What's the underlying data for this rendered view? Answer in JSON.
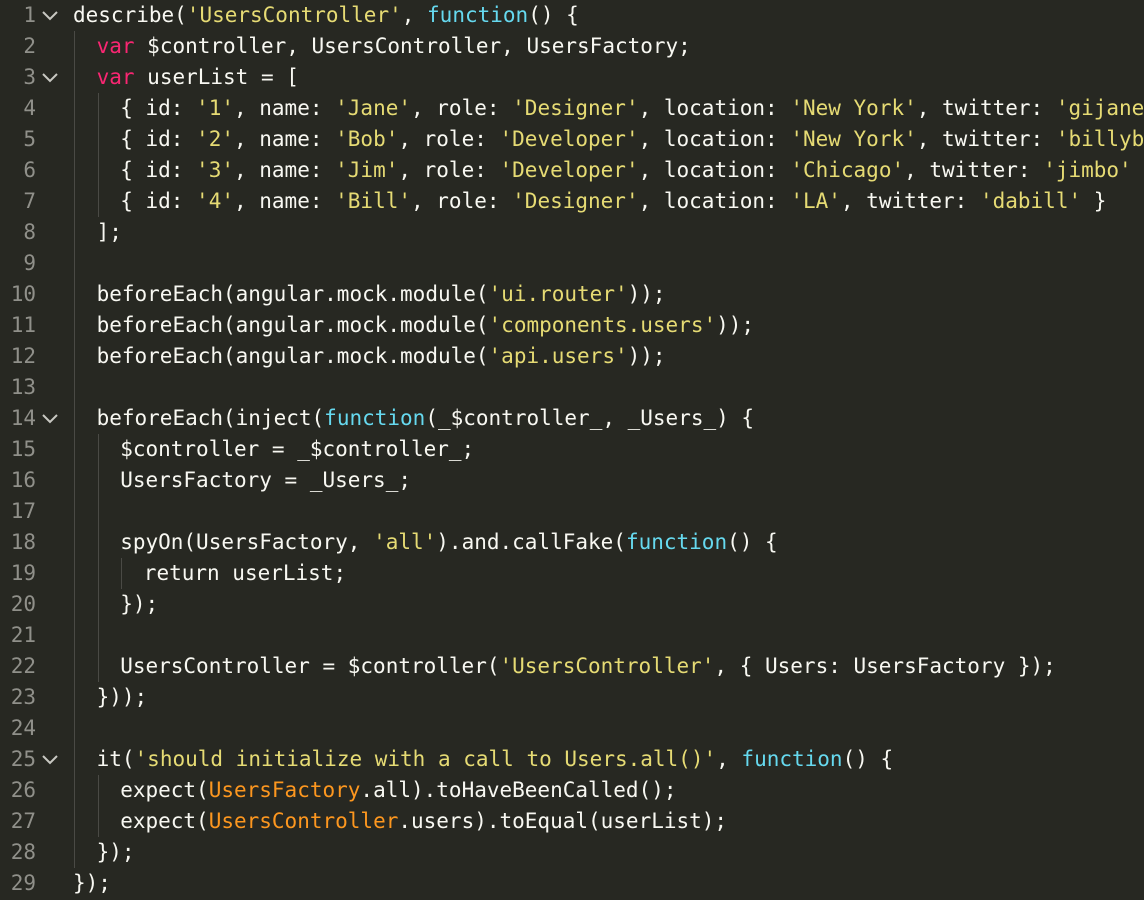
{
  "editor": {
    "theme": {
      "background": "#272822",
      "plain": "#f8f8f2",
      "string": "#e6db74",
      "keyword": "#f92672",
      "function": "#66d9ef",
      "variable": "#fd971f",
      "gutter": "#90908a"
    },
    "fold_icon": "chevron-down-icon",
    "lines": [
      {
        "num": "1",
        "fold": true,
        "indent": 0,
        "tokens": [
          {
            "t": "describe(",
            "c": "plain"
          },
          {
            "t": "'UsersController'",
            "c": "str"
          },
          {
            "t": ", ",
            "c": "plain"
          },
          {
            "t": "function",
            "c": "fn"
          },
          {
            "t": "() {",
            "c": "plain"
          }
        ]
      },
      {
        "num": "2",
        "fold": false,
        "indent": 1,
        "tokens": [
          {
            "t": "var",
            "c": "kw"
          },
          {
            "t": " $controller, UsersController, UsersFactory;",
            "c": "plain"
          }
        ]
      },
      {
        "num": "3",
        "fold": true,
        "indent": 1,
        "tokens": [
          {
            "t": "var",
            "c": "kw"
          },
          {
            "t": " userList = [",
            "c": "plain"
          }
        ]
      },
      {
        "num": "4",
        "fold": false,
        "indent": 2,
        "tokens": [
          {
            "t": "{ id: ",
            "c": "plain"
          },
          {
            "t": "'1'",
            "c": "str"
          },
          {
            "t": ", name: ",
            "c": "plain"
          },
          {
            "t": "'Jane'",
            "c": "str"
          },
          {
            "t": ", role: ",
            "c": "plain"
          },
          {
            "t": "'Designer'",
            "c": "str"
          },
          {
            "t": ", location: ",
            "c": "plain"
          },
          {
            "t": "'New York'",
            "c": "str"
          },
          {
            "t": ", twitter: ",
            "c": "plain"
          },
          {
            "t": "'gijane'",
            "c": "str"
          },
          {
            "t": " },",
            "c": "plain"
          }
        ]
      },
      {
        "num": "5",
        "fold": false,
        "indent": 2,
        "tokens": [
          {
            "t": "{ id: ",
            "c": "plain"
          },
          {
            "t": "'2'",
            "c": "str"
          },
          {
            "t": ", name: ",
            "c": "plain"
          },
          {
            "t": "'Bob'",
            "c": "str"
          },
          {
            "t": ", role: ",
            "c": "plain"
          },
          {
            "t": "'Developer'",
            "c": "str"
          },
          {
            "t": ", location: ",
            "c": "plain"
          },
          {
            "t": "'New York'",
            "c": "str"
          },
          {
            "t": ", twitter: ",
            "c": "plain"
          },
          {
            "t": "'billybob'",
            "c": "str"
          },
          {
            "t": " },",
            "c": "plain"
          }
        ]
      },
      {
        "num": "6",
        "fold": false,
        "indent": 2,
        "tokens": [
          {
            "t": "{ id: ",
            "c": "plain"
          },
          {
            "t": "'3'",
            "c": "str"
          },
          {
            "t": ", name: ",
            "c": "plain"
          },
          {
            "t": "'Jim'",
            "c": "str"
          },
          {
            "t": ", role: ",
            "c": "plain"
          },
          {
            "t": "'Developer'",
            "c": "str"
          },
          {
            "t": ", location: ",
            "c": "plain"
          },
          {
            "t": "'Chicago'",
            "c": "str"
          },
          {
            "t": ", twitter: ",
            "c": "plain"
          },
          {
            "t": "'jimbo'",
            "c": "str"
          },
          {
            "t": " },",
            "c": "plain"
          }
        ]
      },
      {
        "num": "7",
        "fold": false,
        "indent": 2,
        "tokens": [
          {
            "t": "{ id: ",
            "c": "plain"
          },
          {
            "t": "'4'",
            "c": "str"
          },
          {
            "t": ", name: ",
            "c": "plain"
          },
          {
            "t": "'Bill'",
            "c": "str"
          },
          {
            "t": ", role: ",
            "c": "plain"
          },
          {
            "t": "'Designer'",
            "c": "str"
          },
          {
            "t": ", location: ",
            "c": "plain"
          },
          {
            "t": "'LA'",
            "c": "str"
          },
          {
            "t": ", twitter: ",
            "c": "plain"
          },
          {
            "t": "'dabill'",
            "c": "str"
          },
          {
            "t": " }",
            "c": "plain"
          }
        ]
      },
      {
        "num": "8",
        "fold": false,
        "indent": 1,
        "tokens": [
          {
            "t": "];",
            "c": "plain"
          }
        ]
      },
      {
        "num": "9",
        "fold": false,
        "indent": 1,
        "tokens": []
      },
      {
        "num": "10",
        "fold": false,
        "indent": 1,
        "tokens": [
          {
            "t": "beforeEach(angular.mock.module(",
            "c": "plain"
          },
          {
            "t": "'ui.router'",
            "c": "str"
          },
          {
            "t": "));",
            "c": "plain"
          }
        ]
      },
      {
        "num": "11",
        "fold": false,
        "indent": 1,
        "tokens": [
          {
            "t": "beforeEach(angular.mock.module(",
            "c": "plain"
          },
          {
            "t": "'components.users'",
            "c": "str"
          },
          {
            "t": "));",
            "c": "plain"
          }
        ]
      },
      {
        "num": "12",
        "fold": false,
        "indent": 1,
        "tokens": [
          {
            "t": "beforeEach(angular.mock.module(",
            "c": "plain"
          },
          {
            "t": "'api.users'",
            "c": "str"
          },
          {
            "t": "));",
            "c": "plain"
          }
        ]
      },
      {
        "num": "13",
        "fold": false,
        "indent": 1,
        "tokens": []
      },
      {
        "num": "14",
        "fold": true,
        "indent": 1,
        "tokens": [
          {
            "t": "beforeEach(inject(",
            "c": "plain"
          },
          {
            "t": "function",
            "c": "fn"
          },
          {
            "t": "(_$controller_, _Users_) {",
            "c": "plain"
          }
        ]
      },
      {
        "num": "15",
        "fold": false,
        "indent": 2,
        "tokens": [
          {
            "t": "$controller = _$controller_;",
            "c": "plain"
          }
        ]
      },
      {
        "num": "16",
        "fold": false,
        "indent": 2,
        "tokens": [
          {
            "t": "UsersFactory = _Users_;",
            "c": "plain"
          }
        ]
      },
      {
        "num": "17",
        "fold": false,
        "indent": 2,
        "tokens": []
      },
      {
        "num": "18",
        "fold": false,
        "indent": 2,
        "tokens": [
          {
            "t": "spyOn(UsersFactory, ",
            "c": "plain"
          },
          {
            "t": "'all'",
            "c": "str"
          },
          {
            "t": ").and.callFake(",
            "c": "plain"
          },
          {
            "t": "function",
            "c": "fn"
          },
          {
            "t": "() {",
            "c": "plain"
          }
        ]
      },
      {
        "num": "19",
        "fold": false,
        "indent": 3,
        "tokens": [
          {
            "t": "return userList;",
            "c": "plain"
          }
        ]
      },
      {
        "num": "20",
        "fold": false,
        "indent": 2,
        "tokens": [
          {
            "t": "});",
            "c": "plain"
          }
        ]
      },
      {
        "num": "21",
        "fold": false,
        "indent": 2,
        "tokens": []
      },
      {
        "num": "22",
        "fold": false,
        "indent": 2,
        "tokens": [
          {
            "t": "UsersController = $controller(",
            "c": "plain"
          },
          {
            "t": "'UsersController'",
            "c": "str"
          },
          {
            "t": ", { Users: UsersFactory });",
            "c": "plain"
          }
        ]
      },
      {
        "num": "23",
        "fold": false,
        "indent": 1,
        "tokens": [
          {
            "t": "}));",
            "c": "plain"
          }
        ]
      },
      {
        "num": "24",
        "fold": false,
        "indent": 1,
        "tokens": []
      },
      {
        "num": "25",
        "fold": true,
        "indent": 1,
        "tokens": [
          {
            "t": "it(",
            "c": "plain"
          },
          {
            "t": "'should initialize with a call to Users.all()'",
            "c": "str"
          },
          {
            "t": ", ",
            "c": "plain"
          },
          {
            "t": "function",
            "c": "fn"
          },
          {
            "t": "() {",
            "c": "plain"
          }
        ]
      },
      {
        "num": "26",
        "fold": false,
        "indent": 2,
        "tokens": [
          {
            "t": "expect(",
            "c": "plain"
          },
          {
            "t": "UsersFactory",
            "c": "var"
          },
          {
            "t": ".all).toHaveBeenCalled();",
            "c": "plain"
          }
        ]
      },
      {
        "num": "27",
        "fold": false,
        "indent": 2,
        "tokens": [
          {
            "t": "expect(",
            "c": "plain"
          },
          {
            "t": "UsersController",
            "c": "var"
          },
          {
            "t": ".users).toEqual(userList);",
            "c": "plain"
          }
        ]
      },
      {
        "num": "28",
        "fold": false,
        "indent": 1,
        "tokens": [
          {
            "t": "});",
            "c": "plain"
          }
        ]
      },
      {
        "num": "29",
        "fold": false,
        "indent": 0,
        "tokens": [
          {
            "t": "});",
            "c": "plain"
          }
        ]
      }
    ]
  }
}
